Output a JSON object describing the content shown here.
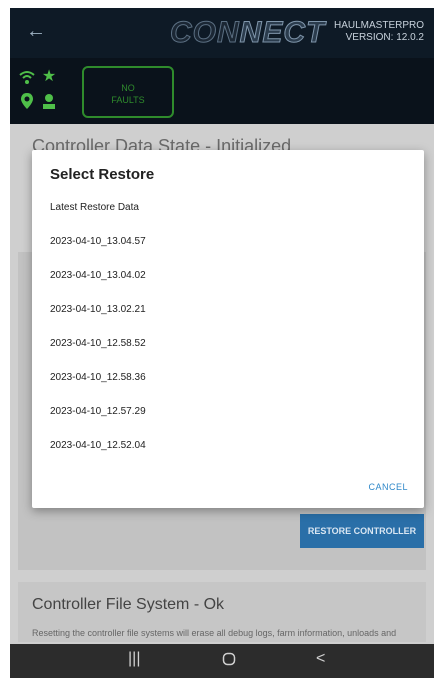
{
  "header": {
    "back_icon": "arrow-left-icon",
    "logo_part1": "CON",
    "logo_part2": "NECT",
    "product": "HAULMASTERPRO",
    "version": "VERSION: 12.0.2"
  },
  "status": {
    "icons": [
      "wifi-icon",
      "star-icon",
      "location-pin-icon",
      "person-icon"
    ],
    "fault_line1": "NO",
    "fault_line2": "FAULTS",
    "icon_color": "#4fbf49"
  },
  "background": {
    "section1_title": "Controller Data State - Initialized",
    "restore_button": "RESTORE CONTROLLER",
    "section2_title": "Controller File System - Ok",
    "section2_desc": "Resetting the controller file systems will erase all debug logs, farm information, unloads and"
  },
  "dialog": {
    "title": "Select Restore",
    "items": [
      "Latest Restore Data",
      "2023-04-10_13.04.57",
      "2023-04-10_13.04.02",
      "2023-04-10_13.02.21",
      "2023-04-10_12.58.52",
      "2023-04-10_12.58.36",
      "2023-04-10_12.57.29",
      "2023-04-10_12.52.04"
    ],
    "cancel": "CANCEL",
    "accent_color": "#2f88c9"
  },
  "navbar": {
    "recents": "|||",
    "home": "O",
    "back": "<"
  }
}
